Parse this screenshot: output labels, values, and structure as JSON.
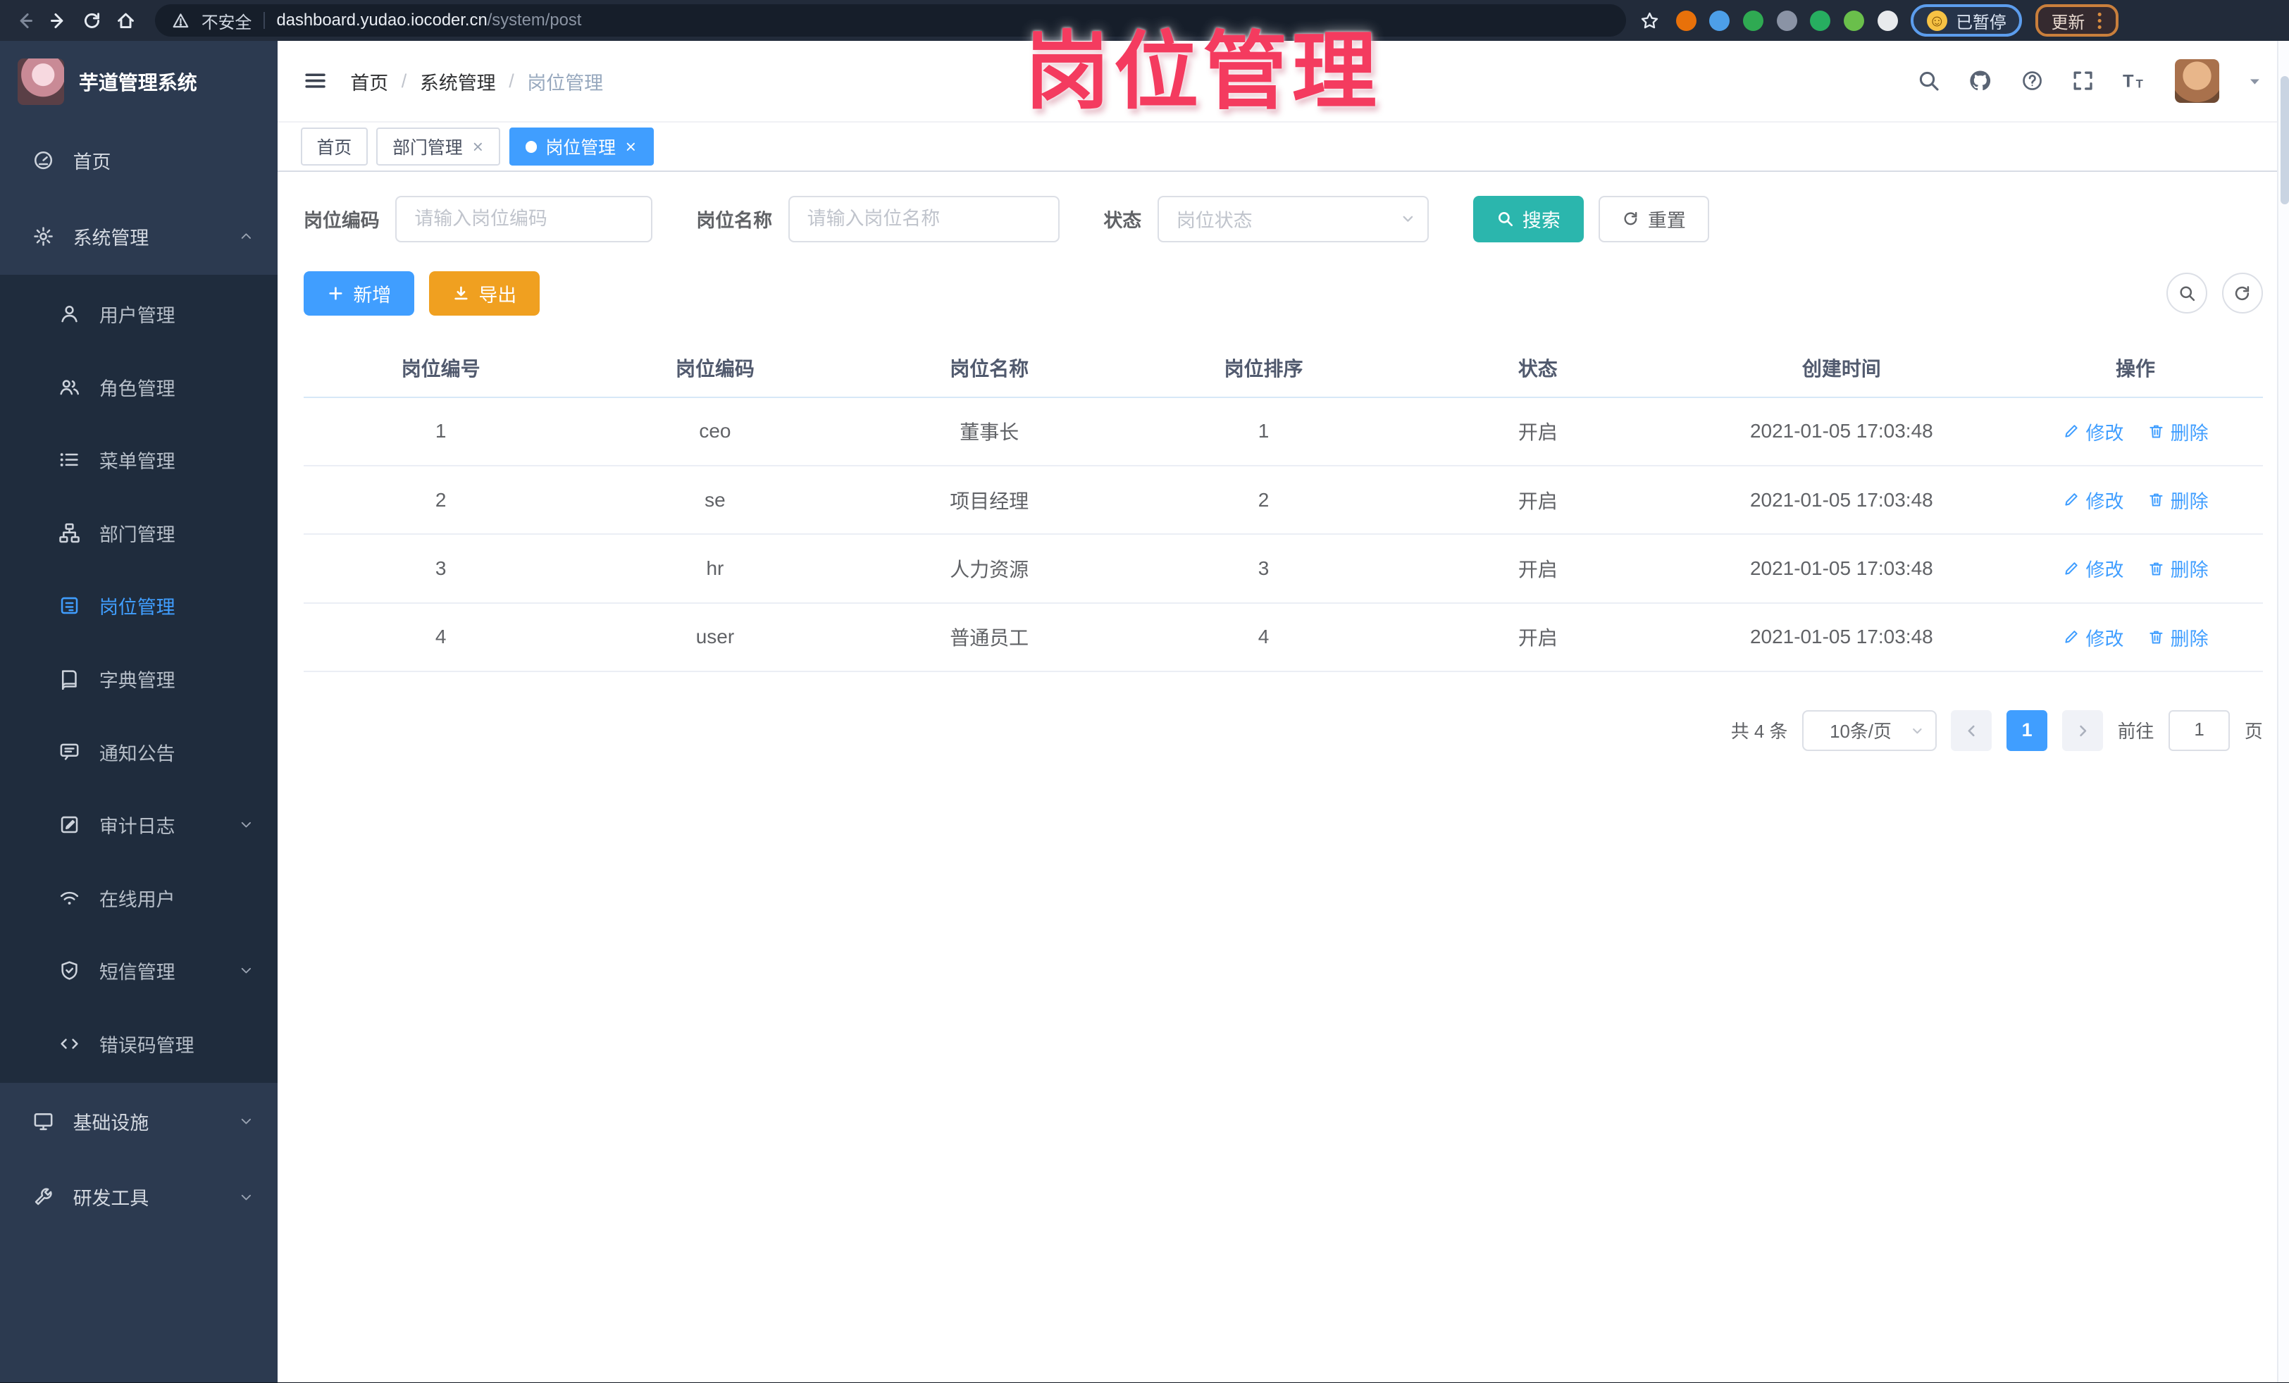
{
  "colors": {
    "primary": "#409EFF",
    "search_button": "#2BB6AD",
    "export_button": "#F0A020",
    "annotation": "#F43B5F",
    "sidebar_bg": "#2C3A50",
    "submenu_bg": "#1F2C3D"
  },
  "annotation": {
    "text": "岗位管理"
  },
  "browser": {
    "security_label": "不安全",
    "url_host": "dashboard.yudao.iocoder.cn",
    "url_path": "/system/post",
    "paused_badge": "已暂停",
    "update_button": "更新",
    "extensions": [
      {
        "icon": "orange-ring-extension-icon",
        "color": "#e8710a"
      },
      {
        "icon": "blue-pin-extension-icon",
        "color": "#4d9fe8"
      },
      {
        "icon": "green-shield-extension-icon",
        "color": "#2faa52"
      },
      {
        "icon": "grid-blue-dot-extension-icon",
        "color": "#8a93a5"
      },
      {
        "icon": "ctr-badge-extension-icon",
        "color": "#27ae60"
      },
      {
        "icon": "sprout-extension-icon",
        "color": "#6abf4b"
      },
      {
        "icon": "puzzle-extension-icon",
        "color": "#e8eaed"
      }
    ]
  },
  "sidebar": {
    "app_title": "芋道管理系统",
    "menu": [
      {
        "id": "home",
        "label": "首页",
        "icon": "dashboard-icon"
      },
      {
        "id": "system",
        "label": "系统管理",
        "icon": "gear-icon",
        "chevron": "up",
        "active_parent": true,
        "children": [
          {
            "id": "user",
            "label": "用户管理",
            "icon": "user-icon"
          },
          {
            "id": "role",
            "label": "角色管理",
            "icon": "users-icon"
          },
          {
            "id": "menu",
            "label": "菜单管理",
            "icon": "menu-list-icon"
          },
          {
            "id": "dept",
            "label": "部门管理",
            "icon": "org-tree-icon"
          },
          {
            "id": "post",
            "label": "岗位管理",
            "icon": "post-badge-icon",
            "active": true
          },
          {
            "id": "dict",
            "label": "字典管理",
            "icon": "dict-book-icon"
          },
          {
            "id": "notice",
            "label": "通知公告",
            "icon": "announcement-icon"
          },
          {
            "id": "audit",
            "label": "审计日志",
            "icon": "audit-log-icon",
            "chevron": "down"
          },
          {
            "id": "online",
            "label": "在线用户",
            "icon": "online-user-icon"
          },
          {
            "id": "sms",
            "label": "短信管理",
            "icon": "sms-shield-icon",
            "chevron": "down"
          },
          {
            "id": "errcode",
            "label": "错误码管理",
            "icon": "error-code-icon"
          }
        ]
      },
      {
        "id": "infra",
        "label": "基础设施",
        "icon": "infra-monitor-icon",
        "chevron": "down"
      },
      {
        "id": "tools",
        "label": "研发工具",
        "icon": "dev-tool-icon",
        "chevron": "down"
      }
    ]
  },
  "header": {
    "breadcrumb": [
      "首页",
      "系统管理",
      "岗位管理"
    ],
    "action_icons": [
      "search-icon",
      "github-icon",
      "question-icon",
      "fullscreen-icon",
      "font-size-icon"
    ]
  },
  "tabs": {
    "items": [
      {
        "id": "home",
        "label": "首页",
        "closable": false,
        "active": false
      },
      {
        "id": "dept",
        "label": "部门管理",
        "closable": true,
        "active": false
      },
      {
        "id": "post",
        "label": "岗位管理",
        "closable": true,
        "active": true
      }
    ]
  },
  "filter": {
    "code_label": "岗位编码",
    "code_placeholder": "请输入岗位编码",
    "name_label": "岗位名称",
    "name_placeholder": "请输入岗位名称",
    "status_label": "状态",
    "status_placeholder": "岗位状态",
    "search_label": "搜索",
    "reset_label": "重置"
  },
  "toolbar": {
    "add_label": "新增",
    "export_label": "导出"
  },
  "table": {
    "columns": [
      "岗位编号",
      "岗位编码",
      "岗位名称",
      "岗位排序",
      "状态",
      "创建时间",
      "操作"
    ],
    "rows": [
      {
        "no": "1",
        "code": "ceo",
        "name": "董事长",
        "sort": "1",
        "status": "开启",
        "created": "2021-01-05 17:03:48"
      },
      {
        "no": "2",
        "code": "se",
        "name": "项目经理",
        "sort": "2",
        "status": "开启",
        "created": "2021-01-05 17:03:48"
      },
      {
        "no": "3",
        "code": "hr",
        "name": "人力资源",
        "sort": "3",
        "status": "开启",
        "created": "2021-01-05 17:03:48"
      },
      {
        "no": "4",
        "code": "user",
        "name": "普通员工",
        "sort": "4",
        "status": "开启",
        "created": "2021-01-05 17:03:48"
      }
    ],
    "actions": {
      "edit": "修改",
      "delete": "删除"
    }
  },
  "pagination": {
    "total": "共 4 条",
    "page_size": "10条/页",
    "current_page": "1",
    "jump_prefix": "前往",
    "jump_value": "1",
    "jump_suffix": "页"
  }
}
